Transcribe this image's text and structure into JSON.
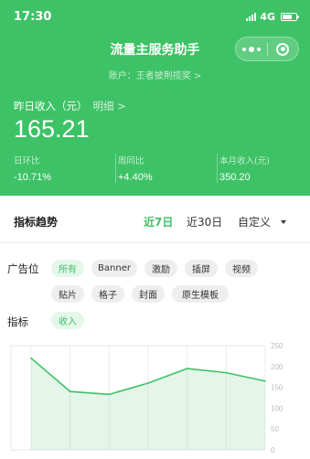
{
  "status": {
    "time": "17:30",
    "network": "4G"
  },
  "nav": {
    "title": "流量主服务助手"
  },
  "account": {
    "text": "账户：王者披荆揽奖 >"
  },
  "income": {
    "label": "昨日收入（元）",
    "detail": "明细 >",
    "value": "165.21",
    "metrics": [
      {
        "label": "日环比",
        "value": "-10.71%"
      },
      {
        "label": "周同比",
        "value": "+4.40%"
      },
      {
        "label": "本月收入(元)",
        "value": "350.20"
      }
    ]
  },
  "trend": {
    "title": "指标趋势",
    "tabs": [
      "近7日",
      "近30日",
      "自定义"
    ],
    "active_tab": "近7日"
  },
  "filters": {
    "ad_label": "广告位",
    "ad_options": [
      "所有",
      "Banner",
      "激励",
      "插屏",
      "视频",
      "贴片",
      "格子",
      "封面",
      "原生模板"
    ],
    "ad_selected": "所有",
    "metric_label": "指标",
    "metric_options": [
      "收入"
    ],
    "metric_selected": "收入"
  },
  "colors": {
    "brand": "#3ec266",
    "chip_bg": "#eeeeee",
    "chip_selected_bg": "#e5f7ea"
  },
  "chart_data": {
    "type": "area",
    "x": [
      1,
      2,
      3,
      4,
      5,
      6,
      7
    ],
    "series": [
      {
        "values": [
          220,
          140,
          133,
          160,
          195,
          185,
          165
        ]
      }
    ],
    "ylim": [
      0,
      250
    ],
    "yticks": [
      "250",
      "200",
      "150",
      "100",
      "50",
      "0"
    ],
    "grid": true
  }
}
